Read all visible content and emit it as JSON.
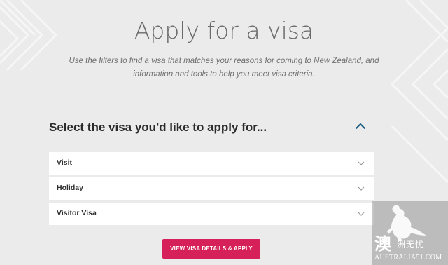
{
  "header": {
    "title": "Apply for a visa",
    "subtitle_line1": "Use the filters to find a visa that matches your reasons for coming to New Zealand, and",
    "subtitle_line2": "information and tools to help you meet visa criteria."
  },
  "selector": {
    "heading": "Select the visa you'd like to apply for...",
    "toggle_icon": "chevron-up-icon",
    "dropdowns": [
      {
        "value": "Visit",
        "icon": "chevron-down-icon"
      },
      {
        "value": "Holiday",
        "icon": "chevron-down-icon"
      },
      {
        "value": "Visitor Visa",
        "icon": "chevron-down-icon"
      }
    ]
  },
  "action": {
    "apply_label": "VIEW VISA DETAILS & APPLY"
  },
  "watermark": {
    "char_large": "澳",
    "chars_small": "洲无忧",
    "site": "AUSTRALIA51.COM",
    "icon": "kangaroo-icon"
  },
  "colors": {
    "accent": "#d6205a",
    "background": "#ebebeb",
    "toggle": "#1d5d82"
  }
}
